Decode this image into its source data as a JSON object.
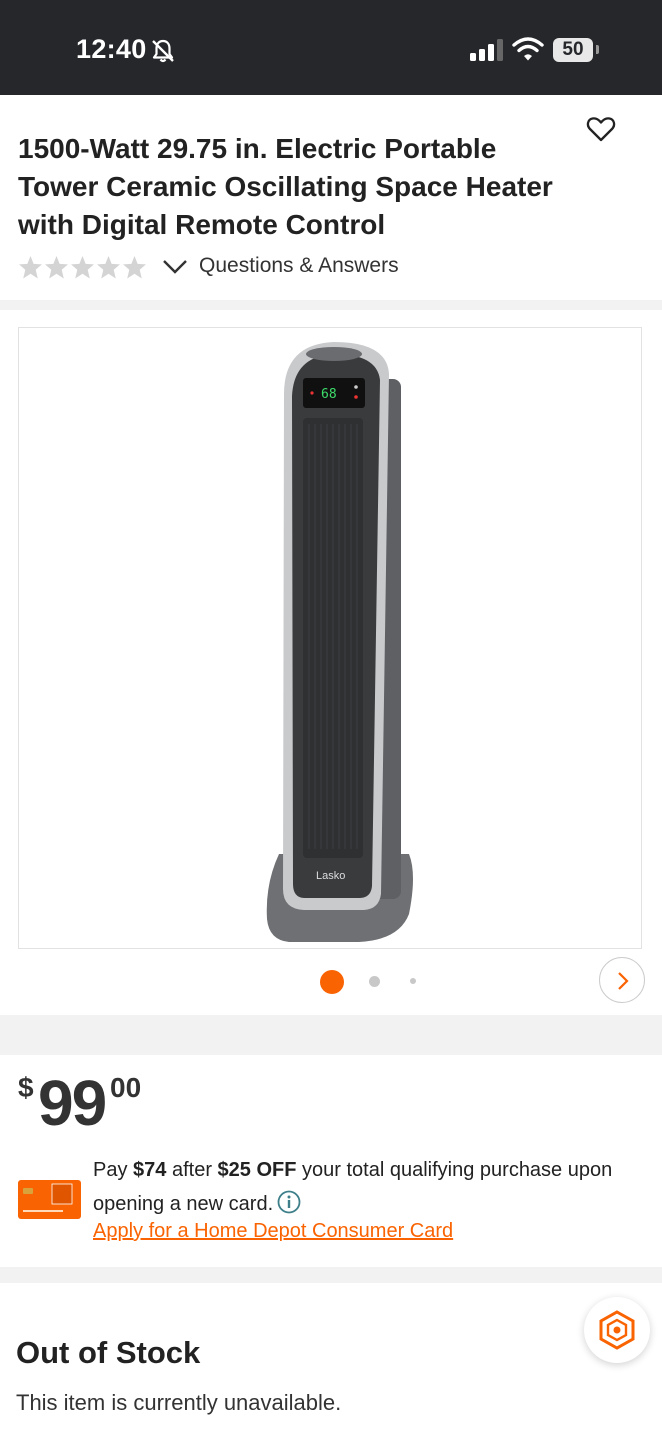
{
  "status_bar": {
    "time": "12:40",
    "battery": "50",
    "icons": [
      "bell-slash-icon",
      "signal-icon",
      "wifi-icon",
      "battery-icon"
    ]
  },
  "product": {
    "title": "1500-Watt 29.75 in. Electric Portable Tower Ceramic Oscillating Space Heater with Digital Remote Control",
    "rating_stars_filled": 0,
    "rating_stars_total": 5,
    "qa_label": "Questions & Answers",
    "image": {
      "brand_label": "Lasko",
      "display_reading": "68"
    },
    "carousel": {
      "dots": 3,
      "active_index": 0
    }
  },
  "price": {
    "currency": "$",
    "whole": "99",
    "cents": "00"
  },
  "promo": {
    "pay_prefix": "Pay ",
    "pay_amount": "$74",
    "after": " after ",
    "discount": "$25 OFF",
    "rest": " your total qualifying purchase upon opening a new card.",
    "apply_label": "Apply for a Home Depot Consumer Card"
  },
  "stock": {
    "title": "Out of Stock",
    "message": "This item is currently unavailable."
  },
  "colors": {
    "accent": "#f96302",
    "status_bar": "#25272a",
    "text": "#222222",
    "info_teal": "#3e7f8a"
  }
}
